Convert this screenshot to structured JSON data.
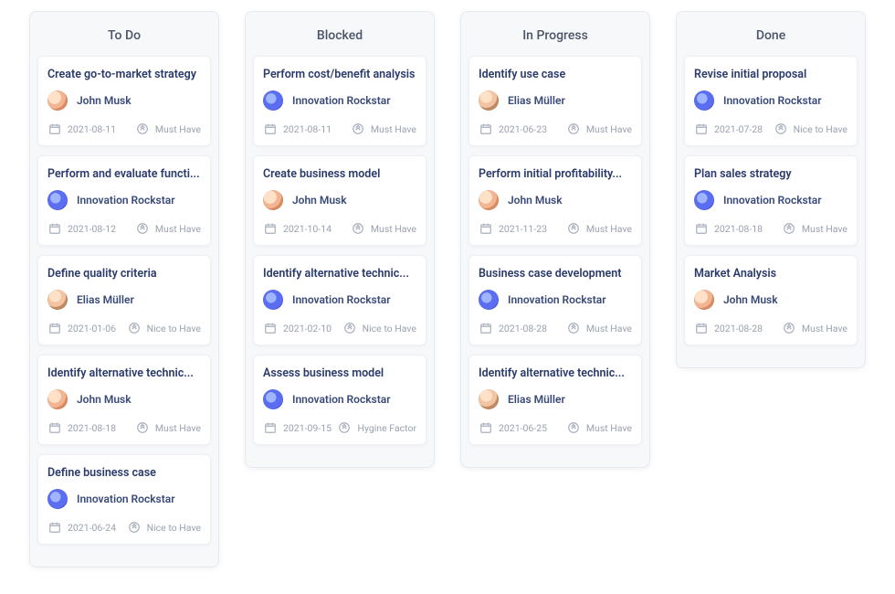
{
  "assignees": {
    "john": {
      "name": "John Musk",
      "avatarClass": "john"
    },
    "innovation": {
      "name": "Innovation Rockstar",
      "avatarClass": "innovation"
    },
    "elias": {
      "name": "Elias Müller",
      "avatarClass": "elias"
    }
  },
  "columns": [
    {
      "title": "To Do",
      "cards": [
        {
          "title": "Create go-to-market strategy",
          "assignee": "john",
          "date": "2021-08-11",
          "priority": "Must Have"
        },
        {
          "title": "Perform and evaluate functi...",
          "assignee": "innovation",
          "date": "2021-08-12",
          "priority": "Must Have"
        },
        {
          "title": "Define quality criteria",
          "assignee": "elias",
          "date": "2021-01-06",
          "priority": "Nice to Have"
        },
        {
          "title": "Identify alternative technic...",
          "assignee": "john",
          "date": "2021-08-18",
          "priority": "Must Have"
        },
        {
          "title": "Define business case",
          "assignee": "innovation",
          "date": "2021-06-24",
          "priority": "Nice to Have"
        }
      ]
    },
    {
      "title": "Blocked",
      "cards": [
        {
          "title": "Perform cost/benefit analysis",
          "assignee": "innovation",
          "date": "2021-08-11",
          "priority": "Must Have"
        },
        {
          "title": "Create business model",
          "assignee": "john",
          "date": "2021-10-14",
          "priority": "Must Have"
        },
        {
          "title": "Identify alternative technic...",
          "assignee": "innovation",
          "date": "2021-02-10",
          "priority": "Nice to Have"
        },
        {
          "title": "Assess business model",
          "assignee": "innovation",
          "date": "2021-09-15",
          "priority": "Hygine Factor"
        }
      ]
    },
    {
      "title": "In Progress",
      "cards": [
        {
          "title": "Identify use case",
          "assignee": "elias",
          "date": "2021-06-23",
          "priority": "Must Have"
        },
        {
          "title": "Perform initial profitability...",
          "assignee": "john",
          "date": "2021-11-23",
          "priority": "Must Have"
        },
        {
          "title": "Business case development",
          "assignee": "innovation",
          "date": "2021-08-28",
          "priority": "Must Have"
        },
        {
          "title": "Identify alternative technic...",
          "assignee": "elias",
          "date": "2021-06-25",
          "priority": "Must Have"
        }
      ]
    },
    {
      "title": "Done",
      "cards": [
        {
          "title": "Revise initial proposal",
          "assignee": "innovation",
          "date": "2021-07-28",
          "priority": "Nice to Have"
        },
        {
          "title": "Plan sales strategy",
          "assignee": "innovation",
          "date": "2021-08-18",
          "priority": "Must Have"
        },
        {
          "title": "Market Analysis",
          "assignee": "john",
          "date": "2021-08-28",
          "priority": "Must Have"
        }
      ]
    }
  ]
}
